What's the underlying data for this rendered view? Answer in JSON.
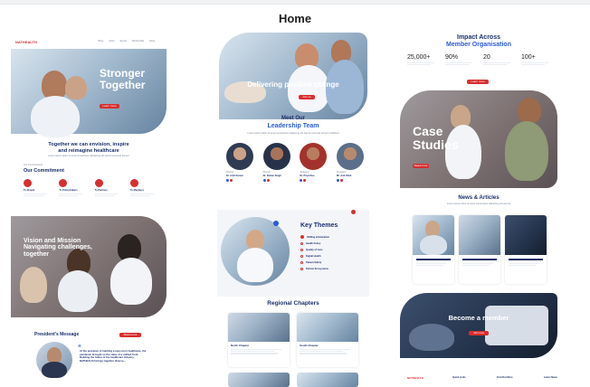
{
  "page": {
    "title": "Home"
  },
  "col1": {
    "logo": "NATHEALTH",
    "nav": [
      "Home",
      "About",
      "Events",
      "Membership",
      "News",
      "Contact"
    ],
    "hero_title": "Stronger Together",
    "hero_cta": "Learn more",
    "tagline_line1": "Together we can envision, inspire",
    "tagline_line2": "and reimagine healthcare",
    "tagline_sub": "Lorem ipsum dolor sit amet consectetur adipiscing elit sed do eiusmod tempor",
    "commitment_kicker": "Our Commitments",
    "commitment_title": "Our Commitment",
    "commitments": [
      {
        "label": "To People"
      },
      {
        "label": "To Policymakers"
      },
      {
        "label": "To Partners"
      },
      {
        "label": "To Members"
      }
    ],
    "vision_title": "Vision and Mission Navigating challenges, together",
    "president_title": "President's Message",
    "president_cta": "Read more",
    "president_quote": "At the precipice of marking a new era in healthcare, the pandemic brought on the value of a unified front. Building the future of the healthcare industry, NATHEALTH brings together diverse..."
  },
  "col2": {
    "hero_title": "Delivering positive change",
    "hero_cta": "Join us",
    "leadership_kicker": "Meet Our",
    "leadership_title": "Leadership Team",
    "leadership_sub": "Lorem ipsum dolor sit amet consectetur adipiscing elit sed do eiusmod tempor incididunt",
    "leaders": [
      {
        "role": "Director",
        "name": "Dr. Amit Kumar"
      },
      {
        "role": "Director",
        "name": "Dr. Rohan Singh"
      },
      {
        "role": "Treasurer",
        "name": "Dr. Priya Rao"
      },
      {
        "role": "President",
        "name": "Mr. Anil Shah"
      }
    ],
    "key_themes_title": "Key Themes",
    "themes": [
      "Skilling & Education",
      "Health Policy",
      "Quality of Care",
      "Digital Health",
      "Patient Safety",
      "Partner Ecosystems"
    ],
    "regional_title": "Regional Chapters",
    "chapters": [
      "North Chapter",
      "South Chapter"
    ]
  },
  "col3": {
    "impact_line1": "Impact Across",
    "impact_line2": "Member Organisation",
    "stats": [
      {
        "value": "25,000+"
      },
      {
        "value": "90%"
      },
      {
        "value": "20"
      },
      {
        "value": "100+"
      }
    ],
    "stats_cta": "Learn more",
    "case_title": "Case Studies",
    "case_cta": "Read more",
    "news_title": "News & Articles",
    "news_sub": "Lorem ipsum dolor sit amet consectetur adipiscing elit sed do",
    "member_title": "Become a member",
    "member_cta": "Join now",
    "footer_logo": "NATHEALTH",
    "footer_cols": [
      "Quick Links",
      "Find Out More",
      "Latest News"
    ]
  },
  "colors": {
    "navy": "#1a2f6b",
    "red": "#d72e2e",
    "blue": "#2a5bd7"
  }
}
